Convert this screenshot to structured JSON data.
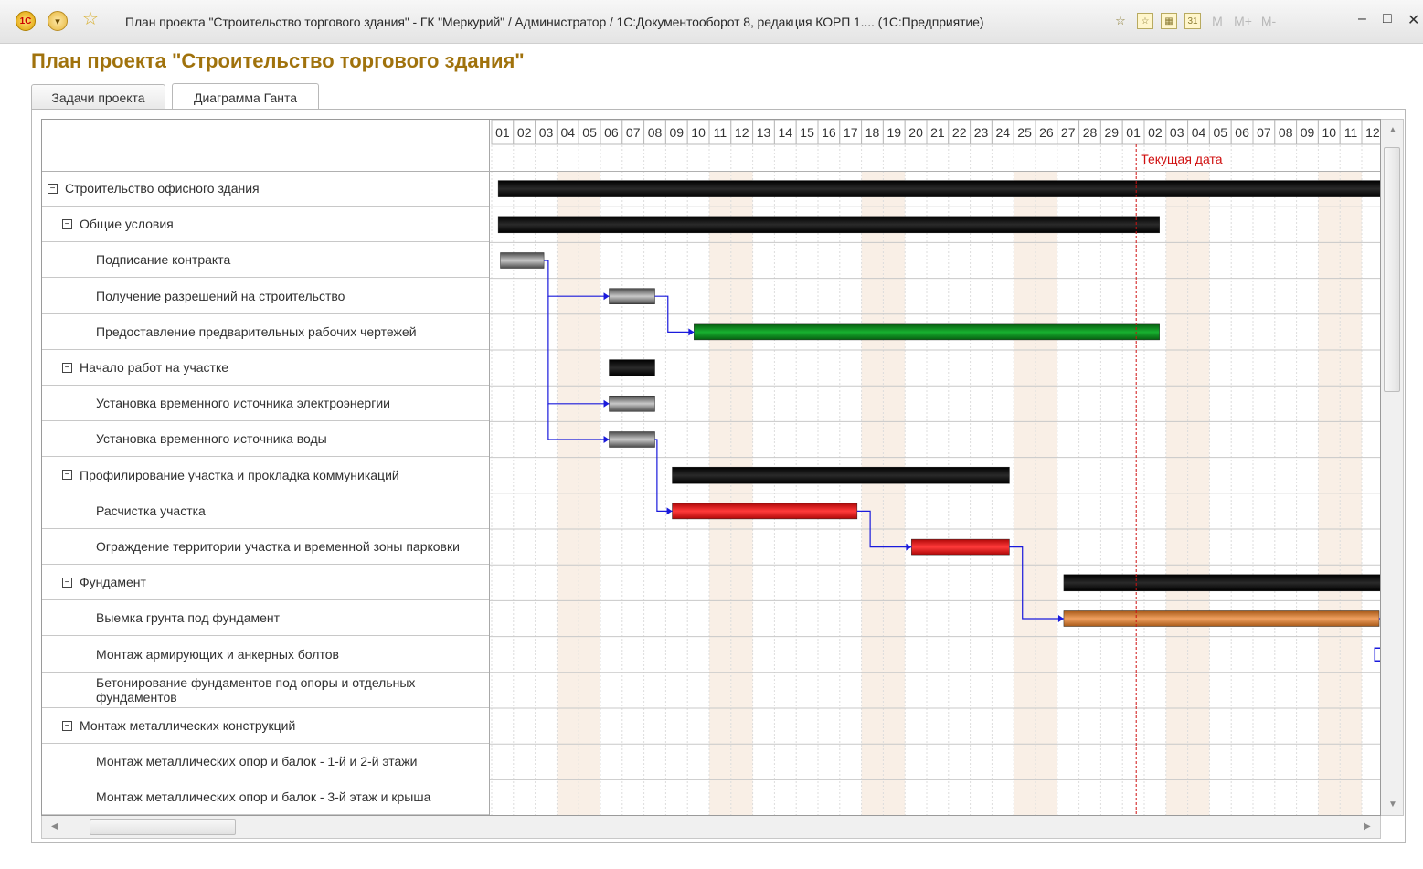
{
  "window": {
    "title": "План проекта \"Строительство торгового здания\" - ГК \"Меркурий\" / Администратор /  1С:Документооборот 8, редакция КОРП 1....  (1С:Предприятие)",
    "logo_text": "1С",
    "menu_glyph": "▾",
    "favorite_glyph": "☆",
    "tool_icons": [
      "☆",
      "☆",
      "▦",
      "31"
    ],
    "memory_buttons": [
      "M",
      "M+",
      "M-"
    ],
    "minimize_glyph": "–",
    "maximize_glyph": "□",
    "close_glyph": "✕"
  },
  "page": {
    "title": "План проекта \"Строительство торгового здания\""
  },
  "tabs": [
    {
      "label": "Задачи проекта",
      "active": false
    },
    {
      "label": "Диаграмма Ганта",
      "active": true
    }
  ],
  "gantt": {
    "day_labels": [
      "01",
      "02",
      "03",
      "04",
      "05",
      "06",
      "07",
      "08",
      "09",
      "10",
      "11",
      "12",
      "13",
      "14",
      "15",
      "16",
      "17",
      "18",
      "19",
      "20",
      "21",
      "22",
      "23",
      "24",
      "25",
      "26",
      "27",
      "28",
      "29",
      "01",
      "02",
      "03",
      "04",
      "05",
      "06",
      "07",
      "08",
      "09",
      "10",
      "11",
      "12"
    ],
    "weekend_columns": [
      3,
      4,
      10,
      11,
      17,
      18,
      24,
      25,
      31,
      32,
      38,
      39
    ],
    "current_date_column": 29,
    "current_date_label": "Текущая дата",
    "colors": {
      "summary": "#000000",
      "gray": "#7a7a7a",
      "green": "#0a8a1a",
      "red": "#e81818",
      "orange": "#c87a30",
      "link": "#1a1adc",
      "weekend": "#f9efe6",
      "current": "#d01010"
    },
    "rows": [
      {
        "label": "Строительство офисного здания",
        "level": 0,
        "group": true,
        "toggle": "−",
        "bar": {
          "start": 0.3,
          "end": 41,
          "color": "summary"
        }
      },
      {
        "label": "Общие условия",
        "level": 1,
        "group": true,
        "toggle": "−",
        "bar": {
          "start": 0.3,
          "end": 30.7,
          "color": "summary"
        }
      },
      {
        "label": "Подписание контракта",
        "level": 2,
        "group": false,
        "bar": {
          "start": 0.4,
          "end": 2.4,
          "color": "gray"
        }
      },
      {
        "label": "Получение разрешений на строительство",
        "level": 2,
        "group": false,
        "bar": {
          "start": 5.4,
          "end": 7.5,
          "color": "gray"
        }
      },
      {
        "label": "Предоставление предварительных рабочих чертежей",
        "level": 2,
        "group": false,
        "bar": {
          "start": 9.3,
          "end": 30.7,
          "color": "green"
        }
      },
      {
        "label": "Начало работ на участке",
        "level": 1,
        "group": true,
        "toggle": "−",
        "bar": {
          "start": 5.4,
          "end": 7.5,
          "color": "summary"
        }
      },
      {
        "label": "Установка временного источника электроэнергии",
        "level": 2,
        "group": false,
        "bar": {
          "start": 5.4,
          "end": 7.5,
          "color": "gray"
        }
      },
      {
        "label": "Установка временного источника воды",
        "level": 2,
        "group": false,
        "bar": {
          "start": 5.4,
          "end": 7.5,
          "color": "gray"
        }
      },
      {
        "label": "Профилирование участка и прокладка коммуникаций",
        "level": 1,
        "group": true,
        "toggle": "−",
        "bar": {
          "start": 8.3,
          "end": 23.8,
          "color": "summary"
        }
      },
      {
        "label": "Расчистка участка",
        "level": 2,
        "group": false,
        "bar": {
          "start": 8.3,
          "end": 16.8,
          "color": "red"
        }
      },
      {
        "label": "Ограждение территории участка и временной зоны парковки",
        "level": 2,
        "group": false,
        "bar": {
          "start": 19.3,
          "end": 23.8,
          "color": "red"
        }
      },
      {
        "label": "Фундамент",
        "level": 1,
        "group": true,
        "toggle": "−",
        "bar": {
          "start": 26.3,
          "end": 41,
          "color": "summary"
        }
      },
      {
        "label": "Выемка грунта под фундамент",
        "level": 2,
        "group": false,
        "bar": {
          "start": 26.3,
          "end": 40.8,
          "color": "orange"
        }
      },
      {
        "label": "Монтаж армирующих и анкерных болтов",
        "level": 2,
        "group": false,
        "bar": null
      },
      {
        "label": "Бетонирование фундаментов под опоры и отдельных фундаментов",
        "level": 2,
        "group": false,
        "bar": null
      },
      {
        "label": "Монтаж металлических конструкций",
        "level": 1,
        "group": true,
        "toggle": "−",
        "bar": null
      },
      {
        "label": "Монтаж металлических опор и балок - 1-й и 2-й этажи",
        "level": 2,
        "group": false,
        "bar": null
      },
      {
        "label": "Монтаж металлических опор и балок - 3-й этаж и крыша",
        "level": 2,
        "group": false,
        "bar": null
      }
    ]
  }
}
